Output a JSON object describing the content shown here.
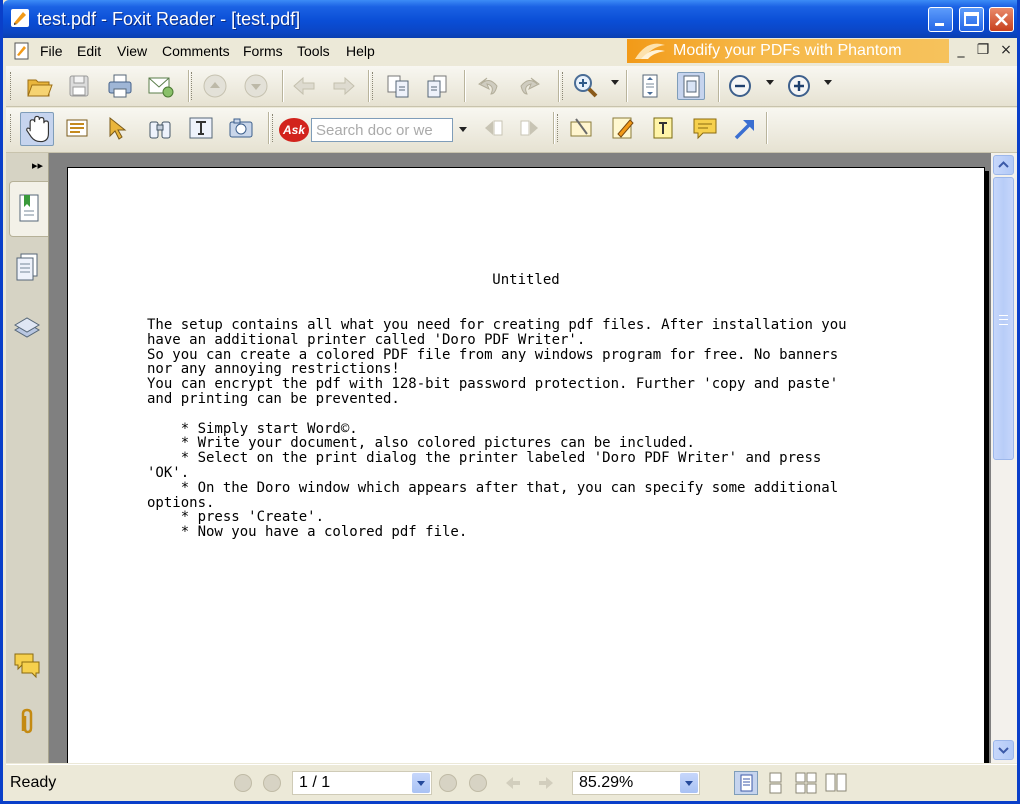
{
  "window": {
    "title": "test.pdf - Foxit Reader - [test.pdf]"
  },
  "menubar": {
    "items": [
      "File",
      "Edit",
      "View",
      "Comments",
      "Forms",
      "Tools",
      "Help"
    ],
    "promo": "Modify your PDFs with Phantom",
    "mdi_min": "_",
    "mdi_restore": "❐",
    "mdi_close": "×"
  },
  "toolbar2": {
    "search_placeholder": "Search doc or we"
  },
  "sidebar": {
    "toggle": "▸▸"
  },
  "document": {
    "title": "Untitled",
    "body": "The setup contains all what you need for creating pdf files. After installation you\nhave an additional printer called 'Doro PDF Writer'.\nSo you can create a colored PDF file from any windows program for free. No banners\nnor any annoying restrictions!\nYou can encrypt the pdf with 128-bit password protection. Further 'copy and paste'\nand printing can be prevented.\n\n    * Simply start Word©.\n    * Write your document, also colored pictures can be included.\n    * Select on the print dialog the printer labeled 'Doro PDF Writer' and press\n'OK'.\n    * On the Doro window which appears after that, you can specify some additional\noptions.\n    * press 'Create'.\n    * Now you have a colored pdf file."
  },
  "statusbar": {
    "status": "Ready",
    "page": "1 / 1",
    "zoom": "85.29%"
  },
  "colors": {
    "titlebar": "#0a4ed6",
    "accent": "#f29a18"
  }
}
